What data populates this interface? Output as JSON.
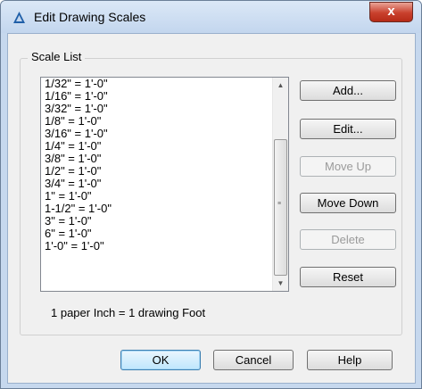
{
  "window": {
    "title": "Edit Drawing Scales",
    "close_label": "x",
    "accent_color": "#1f5fa8"
  },
  "scale_list": {
    "label": "Scale List",
    "items": [
      "1/32\" = 1'-0\"",
      "1/16\" = 1'-0\"",
      "3/32\" = 1'-0\"",
      "1/8\" = 1'-0\"",
      "3/16\" = 1'-0\"",
      "1/4\" = 1'-0\"",
      "3/8\" = 1'-0\"",
      "1/2\" = 1'-0\"",
      "3/4\" = 1'-0\"",
      "1\" = 1'-0\"",
      "1-1/2\" = 1'-0\"",
      "3\" = 1'-0\"",
      "6\" = 1'-0\"",
      "1'-0\" = 1'-0\""
    ]
  },
  "buttons": {
    "add": "Add...",
    "edit": "Edit...",
    "move_up": "Move Up",
    "move_down": "Move Down",
    "delete": "Delete",
    "reset": "Reset",
    "ok": "OK",
    "cancel": "Cancel",
    "help": "Help"
  },
  "status_text": "1 paper Inch = 1 drawing Foot"
}
